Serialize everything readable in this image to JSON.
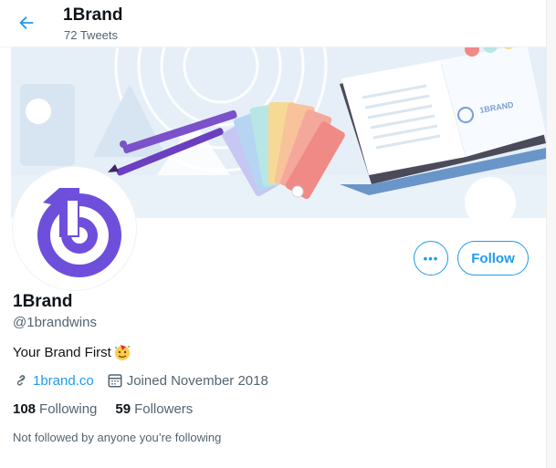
{
  "header": {
    "back_label": "Back",
    "title": "1Brand",
    "tweet_count": "72 Tweets"
  },
  "banner": {
    "book_logo_text": "1BRAND"
  },
  "profile": {
    "name": "1Brand",
    "handle": "@1brandwins",
    "bio": "Your Brand First",
    "bio_emoji": "party-face",
    "website": "1brand.co",
    "joined": "Joined November 2018",
    "following_count": "108",
    "following_label": "Following",
    "followers_count": "59",
    "followers_label": "Followers",
    "mutuals_note": "Not followed by anyone you’re following"
  },
  "actions": {
    "more_label": "•••",
    "follow_label": "Follow"
  },
  "colors": {
    "accent": "#1d9bf0",
    "brand_purple": "#6e4fdc"
  }
}
